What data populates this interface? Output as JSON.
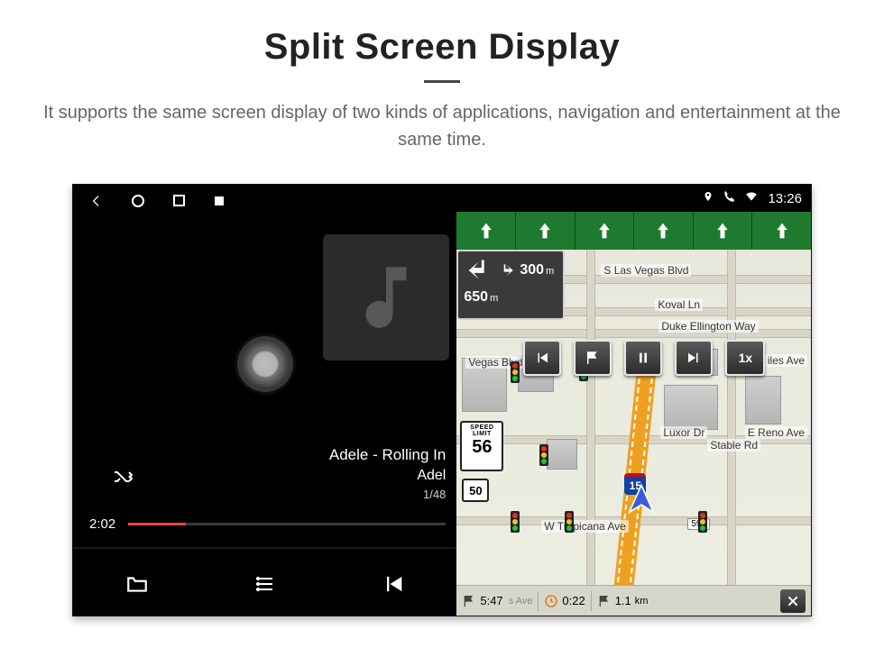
{
  "page": {
    "title": "Split Screen Display",
    "subtitle": "It supports the same screen display of two kinds of applications, navigation and entertainment at the same time."
  },
  "statusbar": {
    "time": "13:26"
  },
  "media": {
    "track_title": "Adele - Rolling In",
    "track_artist": "Adel",
    "track_counter": "1/48",
    "elapsed": "2:02"
  },
  "nav": {
    "turn1_distance_value": "300",
    "turn1_distance_unit": "m",
    "turn2_distance_value": "650",
    "turn2_distance_unit": "m",
    "speed_limit_label": "SPEED LIMIT",
    "speed_limit_value": "56",
    "route_shield": "50",
    "interstate": "15",
    "speed_button": "1x",
    "roads": {
      "s_las_vegas": "S Las Vegas Blvd",
      "koval": "Koval Ln",
      "duke": "Duke Ellington Way",
      "vegas_blvd2": "Vegas Blvd",
      "luxor": "Luxor Dr",
      "stable": "Stable Rd",
      "e_reno": "E Reno Ave",
      "tropicana": "W Tropicana Ave",
      "las_vegas_south": "las Vegas Blvd",
      "iles": "iles Ave"
    },
    "addr_chip": "593",
    "bottom": {
      "eta": "5:47",
      "duration": "0:22",
      "distance_value": "1.1",
      "distance_unit": "km",
      "street_fragment": "s Ave"
    }
  }
}
